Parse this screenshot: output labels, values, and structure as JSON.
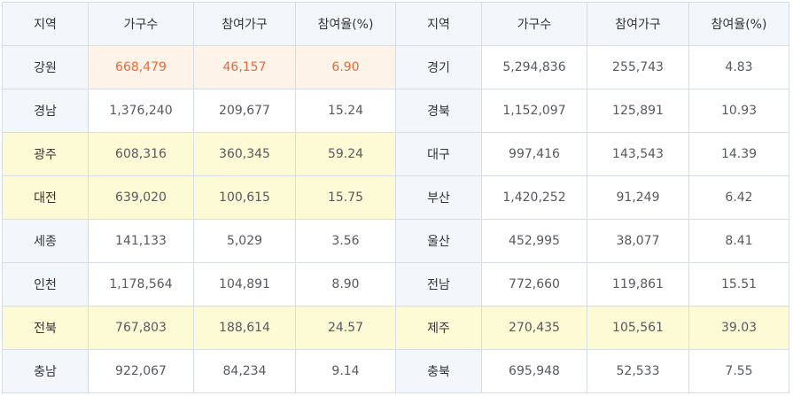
{
  "headers": [
    "지역",
    "가구수",
    "참여가구",
    "참여율(%)",
    "지역",
    "가구수",
    "참여가구",
    "참여율(%)"
  ],
  "rows": [
    {
      "left": {
        "region": "강원",
        "households": "668,479",
        "participants": "46,157",
        "rate": "6.90"
      },
      "right": {
        "region": "경기",
        "households": "5,294,836",
        "participants": "255,743",
        "rate": "4.83"
      }
    },
    {
      "left": {
        "region": "경남",
        "households": "1,376,240",
        "participants": "209,677",
        "rate": "15.24"
      },
      "right": {
        "region": "경북",
        "households": "1,152,097",
        "participants": "125,891",
        "rate": "10.93"
      }
    },
    {
      "left": {
        "region": "광주",
        "households": "608,316",
        "participants": "360,345",
        "rate": "59.24"
      },
      "right": {
        "region": "대구",
        "households": "997,416",
        "participants": "143,543",
        "rate": "14.39"
      }
    },
    {
      "left": {
        "region": "대전",
        "households": "639,020",
        "participants": "100,615",
        "rate": "15.75"
      },
      "right": {
        "region": "부산",
        "households": "1,420,252",
        "participants": "91,249",
        "rate": "6.42"
      }
    },
    {
      "left": {
        "region": "세종",
        "households": "141,133",
        "participants": "5,029",
        "rate": "3.56"
      },
      "right": {
        "region": "울산",
        "households": "452,995",
        "participants": "38,077",
        "rate": "8.41"
      }
    },
    {
      "left": {
        "region": "인천",
        "households": "1,178,564",
        "participants": "104,891",
        "rate": "8.90"
      },
      "right": {
        "region": "전남",
        "households": "772,660",
        "participants": "119,861",
        "rate": "15.51"
      }
    },
    {
      "left": {
        "region": "전북",
        "households": "767,803",
        "participants": "188,614",
        "rate": "24.57"
      },
      "right": {
        "region": "제주",
        "households": "270,435",
        "participants": "105,561",
        "rate": "39.03"
      }
    },
    {
      "left": {
        "region": "충남",
        "households": "922,067",
        "participants": "84,234",
        "rate": "9.14"
      },
      "right": {
        "region": "충북",
        "households": "695,948",
        "participants": "52,533",
        "rate": "7.55"
      }
    }
  ],
  "colors": {
    "header_bg": "#f2f7fb",
    "highlight_yellow": "#fdfbd6",
    "highlight_orange_bg": "#fdf3e8",
    "highlight_orange_text": "#ea6a3a",
    "border": "#d6dde6"
  }
}
